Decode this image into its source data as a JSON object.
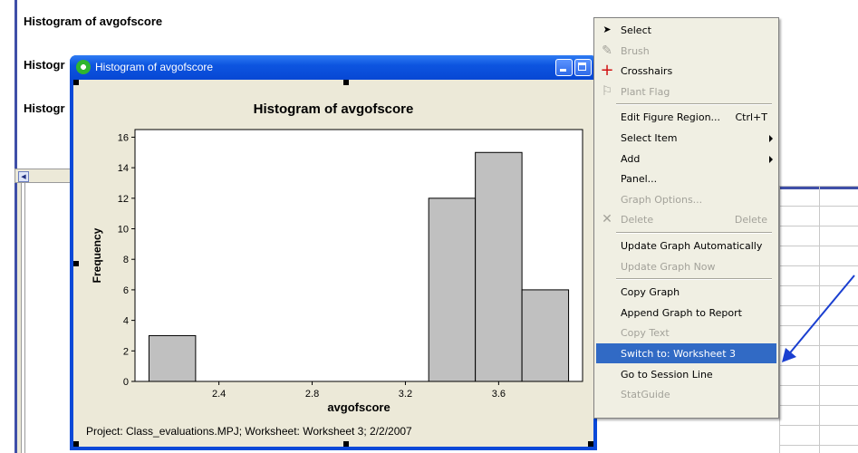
{
  "session": {
    "headings": [
      "Histogram of avgofscore",
      "Histogr",
      "Histogr"
    ]
  },
  "graph_window": {
    "title": "Histogram of avgofscore",
    "footnote": "Project: Class_evaluations.MPJ; Worksheet: Worksheet 3; 2/2/2007"
  },
  "chart_data": {
    "type": "bar",
    "title": "Histogram of avgofscore",
    "xlabel": "avgofscore",
    "ylabel": "Frequency",
    "x_ticks": [
      2.4,
      2.8,
      3.2,
      3.6
    ],
    "x_tick_labels": [
      "2.4",
      "2.8",
      "3.2",
      "3.6"
    ],
    "y_ticks": [
      0,
      2,
      4,
      6,
      8,
      10,
      12,
      14,
      16
    ],
    "y_tick_labels": [
      "0",
      "2",
      "4",
      "6",
      "8",
      "10",
      "12",
      "14",
      "16"
    ],
    "xlim": [
      2.04,
      3.96
    ],
    "ylim": [
      0,
      16.5
    ],
    "bins": [
      {
        "from": 2.1,
        "to": 2.3,
        "count": 3
      },
      {
        "from": 3.3,
        "to": 3.5,
        "count": 12
      },
      {
        "from": 3.5,
        "to": 3.7,
        "count": 15
      },
      {
        "from": 3.7,
        "to": 3.9,
        "count": 6
      }
    ],
    "bar_color": "#c0c0c0",
    "grid": false
  },
  "context_menu": {
    "items": [
      {
        "name": "menu-select",
        "label": "Select",
        "icon": "arrow-cursor-icon",
        "glyph": "➤",
        "enabled": true
      },
      {
        "name": "menu-brush",
        "label": "Brush",
        "icon": "brush-icon",
        "glyph": "✎",
        "enabled": false
      },
      {
        "name": "menu-crosshairs",
        "label": "Crosshairs",
        "icon": "crosshair-icon",
        "glyph": "+",
        "enabled": true
      },
      {
        "name": "menu-plant-flag",
        "label": "Plant Flag",
        "icon": "flag-icon",
        "glyph": "⚐",
        "enabled": false
      },
      {
        "sep": true
      },
      {
        "name": "menu-edit-figure-region",
        "label": "Edit Figure Region...",
        "shortcut": "Ctrl+T",
        "enabled": true
      },
      {
        "name": "menu-select-item",
        "label": "Select Item",
        "submenu": true,
        "enabled": true
      },
      {
        "name": "menu-add",
        "label": "Add",
        "submenu": true,
        "enabled": true
      },
      {
        "name": "menu-panel",
        "label": "Panel...",
        "enabled": true
      },
      {
        "name": "menu-graph-options",
        "label": "Graph Options...",
        "enabled": false
      },
      {
        "name": "menu-delete",
        "label": "Delete",
        "shortcut": "Delete",
        "icon": "delete-x-icon",
        "glyph": "✕",
        "enabled": false
      },
      {
        "sep": true
      },
      {
        "name": "menu-update-graph-automatically",
        "label": "Update Graph Automatically",
        "enabled": true
      },
      {
        "name": "menu-update-graph-now",
        "label": "Update Graph Now",
        "enabled": false
      },
      {
        "sep": true
      },
      {
        "name": "menu-copy-graph",
        "label": "Copy Graph",
        "enabled": true
      },
      {
        "name": "menu-append-graph-to-report",
        "label": "Append Graph to Report",
        "enabled": true
      },
      {
        "name": "menu-copy-text",
        "label": "Copy Text",
        "enabled": false
      },
      {
        "name": "menu-switch-to-worksheet",
        "label": "Switch to: Worksheet 3",
        "enabled": true,
        "highlighted": true
      },
      {
        "name": "menu-go-to-session-line",
        "label": "Go to Session Line",
        "enabled": true
      },
      {
        "name": "menu-statguide",
        "label": "StatGuide",
        "enabled": false
      }
    ]
  },
  "colors": {
    "titlebar": "#0a49d8",
    "menu_highlight": "#316ac5",
    "annotation_arrow": "#1a3fd0"
  }
}
